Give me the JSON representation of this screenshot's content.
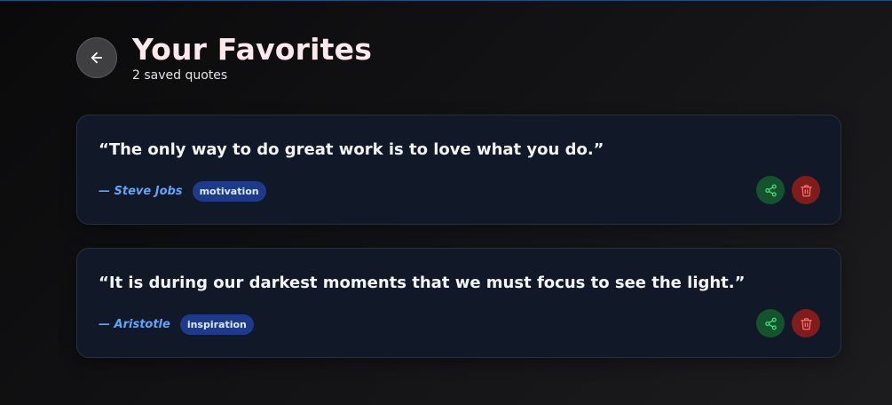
{
  "header": {
    "title": "Your Favorites",
    "subtitle": "2 saved quotes"
  },
  "quotes": [
    {
      "text": "“The only way to do great work is to love what you do.”",
      "author": "— Steve Jobs",
      "tag": "motivation"
    },
    {
      "text": "“It is during our darkest moments that we must focus to see the light.”",
      "author": "— Aristotle",
      "tag": "inspiration"
    }
  ],
  "icons": {
    "back": "arrow-left-icon",
    "share": "share-icon",
    "delete": "trash-icon"
  },
  "colors": {
    "title": "#fde8ee",
    "author": "#60a5fa",
    "tag_bg": "#1e3a8a",
    "share_bg": "#14532d",
    "share_icon": "#4ade80",
    "delete_bg": "#7f1d1d",
    "delete_icon": "#f87171"
  }
}
